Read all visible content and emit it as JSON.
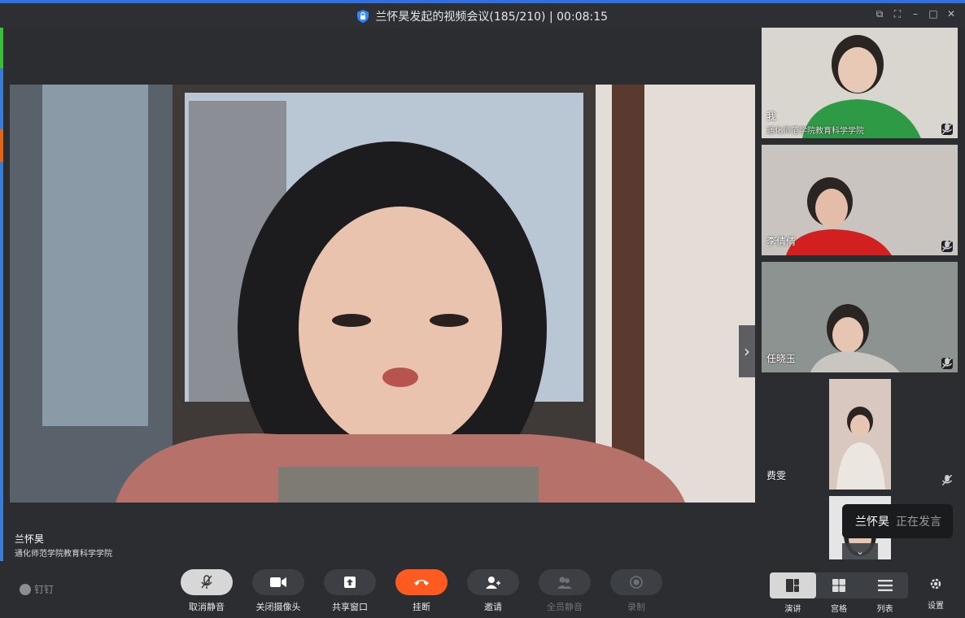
{
  "window": {
    "title": "兰怀昊发起的视频会议(185/210) | 00:08:15"
  },
  "speaker": {
    "name": "兰怀昊",
    "org": "通化师范学院教育科学学院"
  },
  "participants": [
    {
      "name": "我",
      "org": "通化师范学院教育科学学院",
      "shirt": "#2f9a45",
      "bg": "#d9d5cf"
    },
    {
      "name": "李倩倩",
      "org": "",
      "shirt": "#d21f1f",
      "bg": "#c9c4bf"
    },
    {
      "name": "任晓玉",
      "org": "",
      "shirt": "#c9c6c2",
      "bg": "#8d9391"
    },
    {
      "name": "费雯",
      "org": "",
      "shirt": "#ebe6df",
      "bg": "#d8c8bf"
    },
    {
      "name": "",
      "org": "",
      "shirt": "#ffffff",
      "bg": "#e5e5e5"
    }
  ],
  "speaking": {
    "name": "兰怀昊",
    "status": "正在发言"
  },
  "brand": "钉钉",
  "toolbar": {
    "unmute": "取消静音",
    "camera_off": "关闭摄像头",
    "share": "共享窗口",
    "hangup": "挂断",
    "invite": "邀请",
    "mute_all": "全员静音",
    "record": "录制"
  },
  "layout": {
    "speaker": "演讲",
    "grid": "宫格",
    "list": "列表"
  },
  "settings": "设置",
  "colors": {
    "accent": "#2f6fdf",
    "hangup": "#ff5a1f",
    "panel": "#2b2d31"
  }
}
